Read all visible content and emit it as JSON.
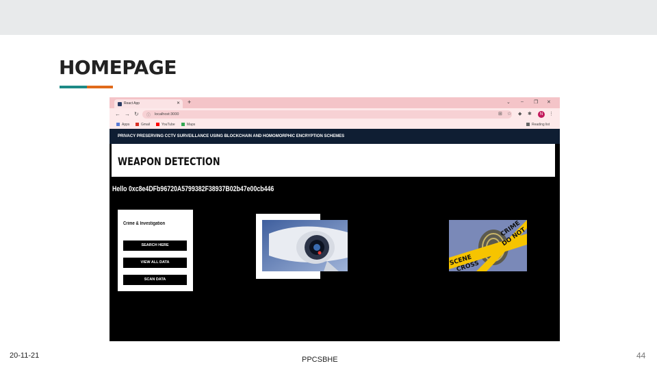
{
  "slide": {
    "title": "HOMEPAGE",
    "footer_date": "20-11-21",
    "footer_center": "PPCSBHE",
    "page_number": "44"
  },
  "browser": {
    "tab_title": "React App",
    "url": "localhost:3000",
    "bookmarks": [
      "Apps",
      "Gmail",
      "YouTube",
      "Maps"
    ],
    "reading_list": "Reading list",
    "profile_initial": "N"
  },
  "app": {
    "header": "PRIVACY PRESERVING CCTV SURVEILLANCE USING BLOCKCHAIN AND HOMOMORPHIC ENCRYPTION SCHEMES",
    "title": "WEAPON DETECTION",
    "greeting": "Hello 0xc8e4DFb96720A5799382F38937B02b47e00cb446",
    "panel_title": "Crime & Investigation",
    "buttons": [
      "SEARCH HERE",
      "VIEW ALL DATA",
      "SCAN DATA"
    ],
    "crime_tape_text": [
      "CRIME",
      "DO NOT",
      "SCENE",
      "CROSS"
    ]
  },
  "colors": {
    "accent_teal": "#1d8a86",
    "accent_orange": "#e06a1b",
    "browser_tab": "#f4c4c8",
    "app_header": "#0f1e33"
  }
}
